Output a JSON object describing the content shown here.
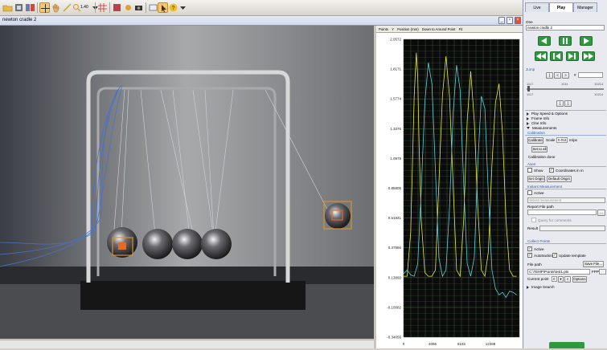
{
  "toolbar": {
    "zoom_value": "1.40"
  },
  "window": {
    "title": "newton cradle 2"
  },
  "chart_header": {
    "points": "Points",
    "axis": "Y",
    "quantity": "Position (mm)",
    "mode": "Down to Around Point",
    "fit": "Fit"
  },
  "chart_data": {
    "type": "line",
    "ylim": [
      -0.34056,
      2.0572
    ],
    "y_ticks": [
      "2.0572",
      "1.8171",
      "1.5774",
      "1.3376",
      "1.0978",
      "0.85805",
      "0.61841",
      "0.37866",
      "0.13892",
      "-0.10082",
      "-0.34056"
    ],
    "x_ticks": [
      "0",
      "4096",
      "8192",
      "12288"
    ],
    "xlim": [
      0,
      16384
    ],
    "colors": {
      "background": "#0b0b0b",
      "grid": "#3c5a3c",
      "series1": "#e8e84a",
      "series2": "#5fd0d8"
    },
    "series": [
      {
        "x": [
          0,
          500,
          1000,
          1500,
          1800,
          2000,
          2200,
          2500,
          3000,
          3500,
          4000,
          4500,
          5000,
          5500,
          6000,
          6500,
          7000,
          7500,
          8000,
          8500,
          9000,
          9500,
          10000,
          10500,
          11000,
          11500,
          12000,
          12500,
          13000,
          13500,
          14000,
          14500,
          15000,
          15500,
          16000
        ],
        "values": [
          0.15,
          0.15,
          0.5,
          1.6,
          1.95,
          1.75,
          1.2,
          0.6,
          0.18,
          0.15,
          0.15,
          0.2,
          0.9,
          1.6,
          1.92,
          1.6,
          0.9,
          0.2,
          0.15,
          0.6,
          1.4,
          1.8,
          1.4,
          0.7,
          0.2,
          0.15,
          0.35,
          1.05,
          1.55,
          1.7,
          1.3,
          0.6,
          0.2,
          0.15,
          0.15
        ]
      },
      {
        "x": [
          0,
          500,
          1000,
          1500,
          2000,
          2500,
          3000,
          3500,
          4000,
          4500,
          5000,
          5500,
          6000,
          6500,
          7000,
          7500,
          8000,
          8500,
          9000,
          9500,
          10000,
          10500,
          11000,
          11500,
          12000,
          12500,
          13000,
          13500,
          14000,
          14500,
          15000,
          15500,
          16000
        ],
        "values": [
          0.17,
          0.2,
          0.16,
          0.15,
          0.25,
          0.85,
          1.55,
          1.87,
          1.7,
          1.0,
          0.3,
          0.15,
          0.2,
          0.7,
          1.45,
          1.85,
          1.65,
          0.9,
          0.25,
          0.15,
          0.3,
          1.05,
          1.6,
          1.5,
          0.8,
          0.2,
          0.05,
          0.0,
          0.02,
          -0.02,
          0.03,
          0.02,
          0.0
        ]
      }
    ]
  },
  "panel": {
    "tabs": [
      "Live",
      "Play",
      "Manager"
    ],
    "active_tab": "Play",
    "one_label": "One",
    "one_value": "newton cradle 2",
    "jump_label": "Jump",
    "jump_hash": "#",
    "frame_labels": [
      "1117",
      "1011",
      "10214"
    ],
    "frame_value": "1117",
    "frame_value_right": "10214",
    "tree": [
      "Play Speed & Options",
      "Frame Info",
      "Clne Info",
      "Measurements"
    ],
    "calibration_header": "Calibration",
    "calibrate_button": "Calibrate",
    "scale_label": "Scale",
    "scale_value": "0.011",
    "scale_unit": "m/px",
    "set_all_button": "Set to all",
    "calibration_status": "Calibration done",
    "axes_header": "Axes",
    "show_label": "Show",
    "coord_label": "Coordinates in m",
    "set_origin_button": "Set Origin",
    "default_origin_button": "Default Origin",
    "instant_header": "Instant Measurement",
    "active_label": "Active",
    "select_measurement": "Select measurement",
    "report_label": "Report File path",
    "query_label": "Query for comments",
    "result_label": "Result",
    "collect_header": "Collect Points",
    "collect_active": "Active",
    "autotrack_label": "Autotracking",
    "update_template_label": "Update template",
    "file_path_label": "File path",
    "save_file_button": "Save File...",
    "file_path_value": "C:\\TEMP\\Points\\test1.pts",
    "fps_label": "FPP",
    "current_point_label": "Current point",
    "current_point_value": "0",
    "options_button": "Options",
    "image_search": "Image Search"
  }
}
